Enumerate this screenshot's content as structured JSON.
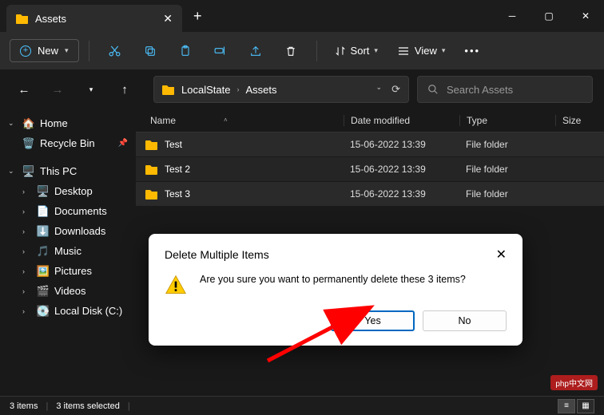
{
  "titlebar": {
    "tab_title": "Assets"
  },
  "toolbar": {
    "new_label": "New",
    "sort_label": "Sort",
    "view_label": "View"
  },
  "navbar": {
    "crumb1": "LocalState",
    "crumb2": "Assets",
    "search_placeholder": "Search Assets"
  },
  "sidebar": {
    "home": "Home",
    "recycle": "Recycle Bin",
    "thispc": "This PC",
    "desktop": "Desktop",
    "documents": "Documents",
    "downloads": "Downloads",
    "music": "Music",
    "pictures": "Pictures",
    "videos": "Videos",
    "localdisk": "Local Disk (C:)"
  },
  "columns": {
    "name": "Name",
    "date": "Date modified",
    "type": "Type",
    "size": "Size"
  },
  "rows": [
    {
      "name": "Test",
      "date": "15-06-2022 13:39",
      "type": "File folder"
    },
    {
      "name": "Test 2",
      "date": "15-06-2022 13:39",
      "type": "File folder"
    },
    {
      "name": "Test 3",
      "date": "15-06-2022 13:39",
      "type": "File folder"
    }
  ],
  "status": {
    "count": "3 items",
    "selected": "3 items selected"
  },
  "dialog": {
    "title": "Delete Multiple Items",
    "message": "Are you sure you want to permanently delete these 3 items?",
    "yes": "Yes",
    "no": "No"
  },
  "watermark": "php中文网"
}
